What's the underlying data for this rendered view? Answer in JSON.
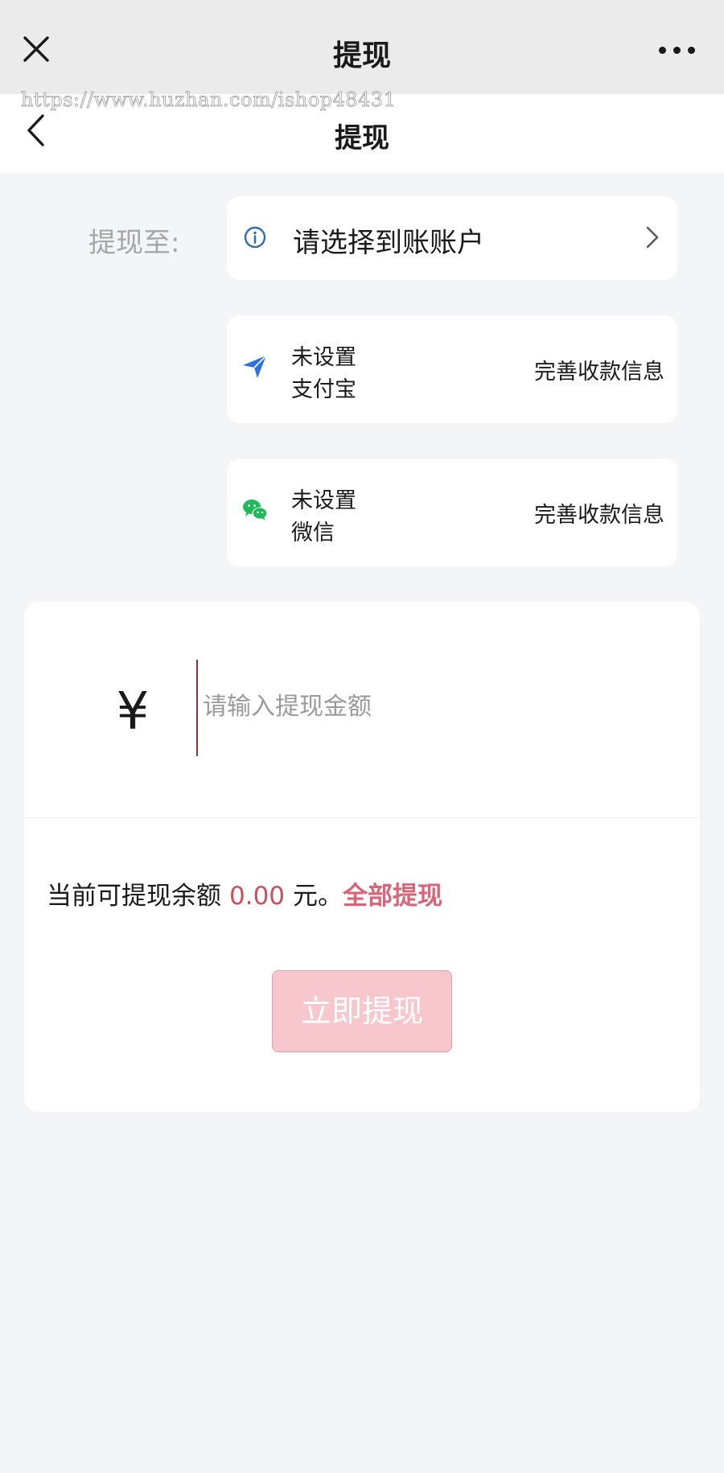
{
  "wechat_bar": {
    "title": "提现"
  },
  "page_nav": {
    "title": "提现"
  },
  "watermark": "https://www.huzhan.com/ishop48431",
  "withdraw_to": {
    "label": "提现至:",
    "account_select_text": "请选择到账账户"
  },
  "methods": [
    {
      "status": "未设置",
      "name": "支付宝",
      "action": "完善收款信息",
      "icon": "alipay-plane-icon",
      "icon_color": "#2f6fe0"
    },
    {
      "status": "未设置",
      "name": "微信",
      "action": "完善收款信息",
      "icon": "wechat-icon",
      "icon_color": "#1fba5a"
    }
  ],
  "amount": {
    "currency_symbol": "¥",
    "placeholder": "请输入提现金额",
    "value": ""
  },
  "balance": {
    "prefix": "当前可提现余额",
    "amount": "0.00",
    "suffix": "元。",
    "withdraw_all": "全部提现"
  },
  "submit": {
    "label": "立即提现"
  },
  "colors": {
    "background": "#f4f5f7",
    "accent": "#d86476",
    "button_disabled": "#f8c6cd",
    "info_blue": "#2f6fb0"
  }
}
